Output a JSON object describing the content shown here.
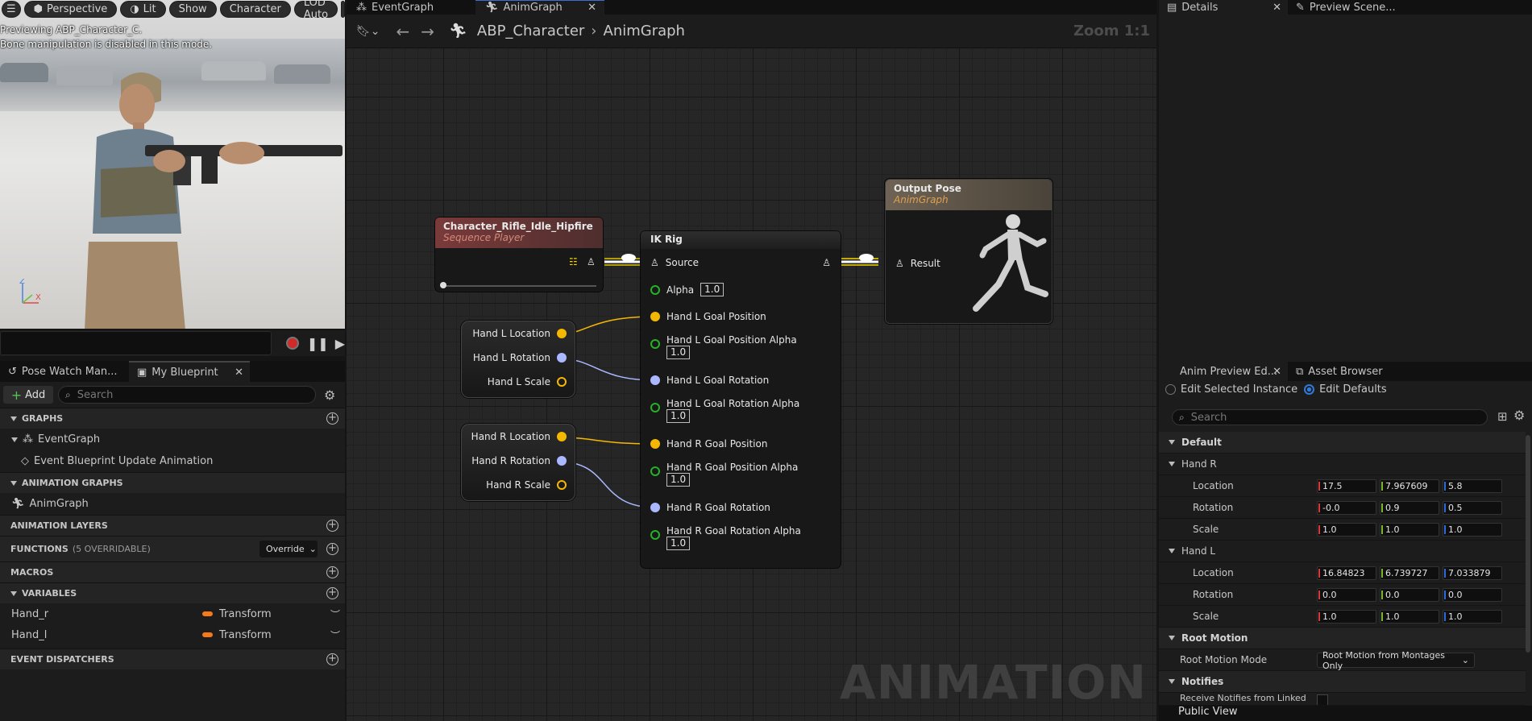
{
  "viewport": {
    "toolbar": {
      "perspective": "Perspective",
      "lit": "Lit",
      "show": "Show",
      "character": "Character",
      "lod": "LOD Auto"
    },
    "info_line1": "Previewing ABP_Character_C.",
    "info_line2": "Bone manipulation is disabled in this mode."
  },
  "left_panel": {
    "tabs": [
      {
        "label": "Pose Watch Man..."
      },
      {
        "label": "My Blueprint"
      }
    ],
    "add_label": "Add",
    "search_placeholder": "Search",
    "sections": {
      "graphs": "GRAPHS",
      "animation_graphs": "ANIMATION GRAPHS",
      "animation_layers": "ANIMATION LAYERS",
      "functions": "FUNCTIONS",
      "functions_count": "(5 OVERRIDABLE)",
      "override": "Override",
      "macros": "MACROS",
      "variables": "VARIABLES",
      "event_dispatchers": "EVENT DISPATCHERS"
    },
    "graphs_items": [
      "EventGraph",
      "Event Blueprint Update Animation"
    ],
    "anim_graph_item": "AnimGraph",
    "variables": [
      {
        "name": "Hand_r",
        "type": "Transform"
      },
      {
        "name": "Hand_l",
        "type": "Transform"
      }
    ]
  },
  "graph": {
    "tabs": [
      {
        "label": "EventGraph"
      },
      {
        "label": "AnimGraph"
      }
    ],
    "breadcrumb": [
      "ABP_Character",
      "AnimGraph"
    ],
    "zoom": "Zoom 1:1",
    "watermark": "ANIMATION",
    "nodes": {
      "sequence_player": {
        "title": "Character_Rifle_Idle_Hipfire",
        "subtitle": "Sequence Player"
      },
      "ik_rig": {
        "title": "IK Rig",
        "source": "Source",
        "alpha": "Alpha",
        "alpha_value": "1.0",
        "pins": [
          "Hand L Goal Position",
          "Hand L Goal Position Alpha",
          "Hand L Goal Rotation",
          "Hand L Goal Rotation Alpha",
          "Hand R Goal Position",
          "Hand R Goal Position Alpha",
          "Hand R Goal Rotation",
          "Hand R Goal Rotation Alpha"
        ],
        "alpha_values": [
          "1.0",
          "1.0",
          "1.0",
          "1.0"
        ]
      },
      "output_pose": {
        "title": "Output Pose",
        "subtitle": "AnimGraph",
        "result": "Result"
      },
      "hand_l": {
        "location": "Hand L Location",
        "rotation": "Hand L Rotation",
        "scale": "Hand L Scale"
      },
      "hand_r": {
        "location": "Hand R Location",
        "rotation": "Hand R Rotation",
        "scale": "Hand R Scale"
      }
    }
  },
  "right_panel": {
    "top_tabs": [
      {
        "label": "Details"
      },
      {
        "label": "Preview Scene..."
      }
    ],
    "bottom_tabs": [
      {
        "label": "Anim Preview Ed..."
      },
      {
        "label": "Asset Browser"
      }
    ],
    "edit_selected": "Edit Selected Instance",
    "edit_defaults": "Edit Defaults",
    "search_placeholder": "Search",
    "default_section": "Default",
    "hand_r": {
      "label": "Hand R",
      "location_label": "Location",
      "rotation_label": "Rotation",
      "scale_label": "Scale",
      "location": [
        "17.5",
        "7.967609",
        "5.8"
      ],
      "rotation": [
        "-0.0",
        "0.9",
        "0.5"
      ],
      "scale": [
        "1.0",
        "1.0",
        "1.0"
      ]
    },
    "hand_l": {
      "label": "Hand L",
      "location_label": "Location",
      "rotation_label": "Rotation",
      "scale_label": "Scale",
      "location": [
        "16.84823",
        "6.739727",
        "7.033879"
      ],
      "rotation": [
        "0.0",
        "0.0",
        "0.0"
      ],
      "scale": [
        "1.0",
        "1.0",
        "1.0"
      ]
    },
    "root_motion": {
      "section": "Root Motion",
      "mode_label": "Root Motion Mode",
      "mode_value": "Root Motion from Montages Only"
    },
    "notifies": {
      "section": "Notifies",
      "receive_label": "Receive Notifies from Linked"
    },
    "public_view": "Public View"
  },
  "colors": {
    "sequence_header": "#7a3a3a",
    "output_header": "#6e6354",
    "pose_wire": "#ffffff",
    "vector_pin": "#f5b800",
    "rotator_pin": "#a9b8ff",
    "float_pin": "#25b225",
    "transform_var": "#f47a1a"
  }
}
